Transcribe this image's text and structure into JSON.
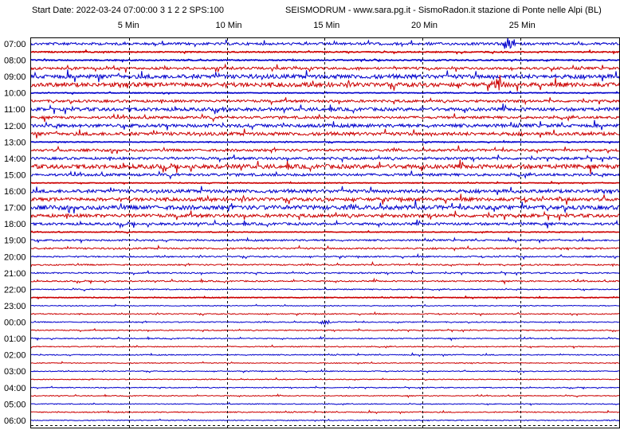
{
  "header": {
    "start_info": "Start Date: 2022-03-24 07:00:00 3 1 2 2 SPS:100",
    "station_title": "SEISMODRUM - www.sara.pg.it - SismoRadon.it stazione di Ponte nelle Alpi (BL)"
  },
  "chart_data": {
    "type": "line",
    "title": "SEISMODRUM - www.sara.pg.it - SismoRadon.it stazione di Ponte nelle Alpi (BL)",
    "xlabel": "",
    "ylabel": "",
    "x_ticks": [
      {
        "minute": 5,
        "label": "5 Min"
      },
      {
        "minute": 10,
        "label": "10 Min"
      },
      {
        "minute": 15,
        "label": "15 Min"
      },
      {
        "minute": 20,
        "label": "20 Min"
      },
      {
        "minute": 25,
        "label": "25 Min"
      }
    ],
    "xlim": [
      0,
      30
    ],
    "hour_labels": [
      "07:00",
      "08:00",
      "09:00",
      "10:00",
      "11:00",
      "12:00",
      "13:00",
      "14:00",
      "15:00",
      "16:00",
      "17:00",
      "18:00",
      "19:00",
      "20:00",
      "21:00",
      "22:00",
      "23:00",
      "00:00",
      "01:00",
      "02:00",
      "03:00",
      "04:00",
      "05:00",
      "06:00"
    ],
    "trace_colors": [
      "#0000cc",
      "#cc0000"
    ],
    "grid_color": "#000000",
    "traces": [
      {
        "amp": 1.5,
        "solid": 0
      },
      {
        "amp": 1.5,
        "solid": 1
      },
      {
        "amp": 1.5,
        "solid": 1
      },
      {
        "amp": 1.5,
        "solid": 0
      },
      {
        "amp": 2.5,
        "solid": 0
      },
      {
        "amp": 2.5,
        "solid": 0
      },
      {
        "amp": 1.0,
        "solid": 1
      },
      {
        "amp": 1.5,
        "solid": 0
      },
      {
        "amp": 2.0,
        "solid": 0
      },
      {
        "amp": 1.5,
        "solid": 0
      },
      {
        "amp": 2.0,
        "solid": 0
      },
      {
        "amp": 2.0,
        "solid": 0
      },
      {
        "amp": 1.0,
        "solid": 1
      },
      {
        "amp": 1.5,
        "solid": 0
      },
      {
        "amp": 1.5,
        "solid": 0
      },
      {
        "amp": 2.5,
        "solid": 0
      },
      {
        "amp": 1.5,
        "solid": 0
      },
      {
        "amp": 1.0,
        "solid": 1
      },
      {
        "amp": 2.0,
        "solid": 0
      },
      {
        "amp": 2.0,
        "solid": 0
      },
      {
        "amp": 2.5,
        "solid": 0
      },
      {
        "amp": 2.0,
        "solid": 0
      },
      {
        "amp": 1.5,
        "solid": 0
      },
      {
        "amp": 1.0,
        "solid": 1
      },
      {
        "amp": 1.0,
        "solid": 0
      },
      {
        "amp": 1.0,
        "solid": 0
      },
      {
        "amp": 0.8,
        "solid": 0
      },
      {
        "amp": 0.8,
        "solid": 0
      },
      {
        "amp": 0.8,
        "solid": 0
      },
      {
        "amp": 0.8,
        "solid": 0
      },
      {
        "amp": 0.6,
        "solid": 0
      },
      {
        "amp": 1.0,
        "solid": 1
      },
      {
        "amp": 0.5,
        "solid": 0
      },
      {
        "amp": 0.6,
        "solid": 0
      },
      {
        "amp": 0.6,
        "solid": 0
      },
      {
        "amp": 0.6,
        "solid": 0
      },
      {
        "amp": 0.6,
        "solid": 0
      },
      {
        "amp": 0.6,
        "solid": 0
      },
      {
        "amp": 0.6,
        "solid": 0
      },
      {
        "amp": 0.5,
        "solid": 0
      },
      {
        "amp": 0.5,
        "solid": 0
      },
      {
        "amp": 0.5,
        "solid": 0
      },
      {
        "amp": 0.5,
        "solid": 0
      },
      {
        "amp": 0.5,
        "solid": 0
      },
      {
        "amp": 0.5,
        "solid": 0
      },
      {
        "amp": 0.6,
        "solid": 0
      },
      {
        "amp": 0.5,
        "solid": 0
      },
      {
        "amp": 0.5,
        "solid": 0
      },
      {
        "amp": 0.6,
        "solid": 0
      },
      {
        "amp": 0.8,
        "solid": 0
      },
      {
        "amp": 1.0,
        "solid": 0
      },
      {
        "amp": 0.8,
        "solid": 0
      },
      {
        "amp": 1.0,
        "solid": 1
      },
      {
        "amp": 1.0,
        "solid": 1
      },
      {
        "amp": 1.5,
        "solid": 0
      }
    ],
    "events": [
      {
        "trace": 0,
        "minute": 24.4,
        "amp": 8
      },
      {
        "trace": 5,
        "minute": 23.9,
        "amp": 10
      },
      {
        "trace": 8,
        "minute": 10.0,
        "amp": 4
      },
      {
        "trace": 54,
        "minute": 15.3,
        "amp": 9
      },
      {
        "trace": 34,
        "minute": 15.0,
        "amp": 3
      }
    ]
  }
}
